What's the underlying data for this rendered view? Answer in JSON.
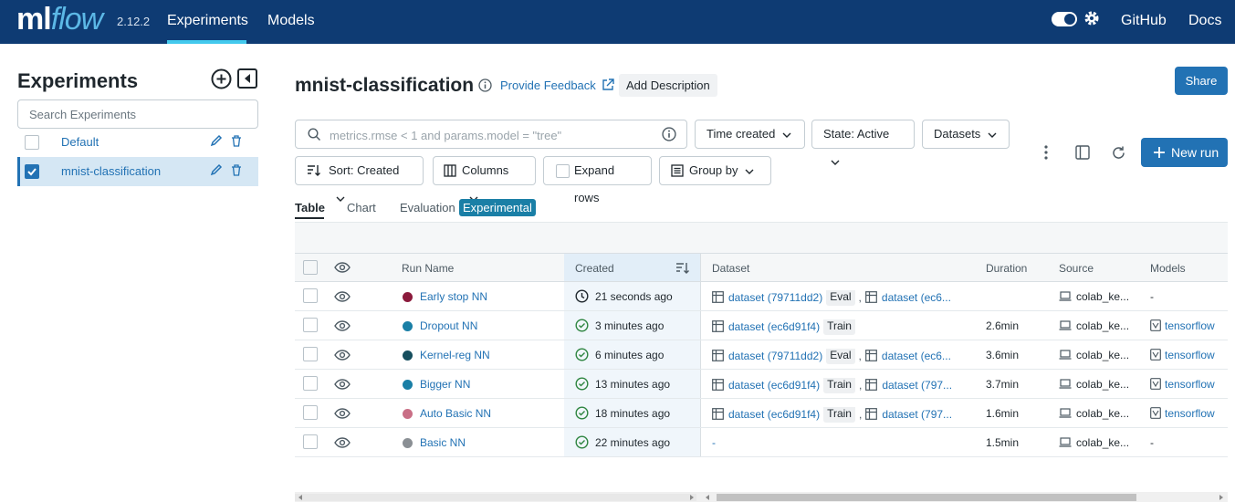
{
  "topbar": {
    "logo_ml": "ml",
    "logo_flow": "flow",
    "version": "2.12.2",
    "nav": [
      {
        "label": "Experiments",
        "active": true
      },
      {
        "label": "Models",
        "active": false
      }
    ],
    "right_links": [
      "GitHub",
      "Docs"
    ],
    "bg_color": "#0e3b73"
  },
  "sidebar": {
    "title": "Experiments",
    "search_placeholder": "Search Experiments",
    "experiments": [
      {
        "name": "Default",
        "checked": false
      },
      {
        "name": "mnist-classification",
        "checked": true
      }
    ]
  },
  "header": {
    "title": "mnist-classification",
    "feedback_label": "Provide Feedback",
    "add_description_label": "Add Description",
    "share_label": "Share"
  },
  "filters": {
    "search_placeholder": "metrics.rmse < 1 and params.model = \"tree\"",
    "time_created": "Time created",
    "state": "State: Active",
    "datasets": "Datasets",
    "sort": "Sort: Created",
    "columns": "Columns",
    "expand_rows": "Expand rows",
    "group_by": "Group by",
    "new_run": "New run"
  },
  "tabs": [
    {
      "label": "Table",
      "active": true
    },
    {
      "label": "Chart",
      "active": false
    },
    {
      "label": "Evaluation",
      "active": false
    }
  ],
  "experimental_badge": "Experimental",
  "table": {
    "headers": {
      "run_name": "Run Name",
      "created": "Created",
      "dataset": "Dataset",
      "duration": "Duration",
      "source": "Source",
      "models": "Models"
    },
    "rows": [
      {
        "name": "Early stop NN",
        "color": "#8b1a3c",
        "created": "21 seconds ago",
        "status": "running",
        "ds1": "dataset (79711dd2)",
        "tag1": "Eval",
        "ds2": "dataset (ec6...",
        "duration": "",
        "source": "colab_ke...",
        "model": "-"
      },
      {
        "name": "Dropout NN",
        "color": "#1a7fa6",
        "created": "3 minutes ago",
        "status": "finished",
        "ds1": "dataset (ec6d91f4)",
        "tag1": "Train",
        "ds2": "",
        "duration": "2.6min",
        "source": "colab_ke...",
        "model": "tensorflow"
      },
      {
        "name": "Kernel-reg NN",
        "color": "#164e5e",
        "created": "6 minutes ago",
        "status": "finished",
        "ds1": "dataset (79711dd2)",
        "tag1": "Eval",
        "ds2": "dataset (ec6...",
        "duration": "3.6min",
        "source": "colab_ke...",
        "model": "tensorflow"
      },
      {
        "name": "Bigger NN",
        "color": "#1a7fa6",
        "created": "13 minutes ago",
        "status": "finished",
        "ds1": "dataset (ec6d91f4)",
        "tag1": "Train",
        "ds2": "dataset (797...",
        "duration": "3.7min",
        "source": "colab_ke...",
        "model": "tensorflow"
      },
      {
        "name": "Auto Basic NN",
        "color": "#c96f86",
        "created": "18 minutes ago",
        "status": "finished",
        "ds1": "dataset (ec6d91f4)",
        "tag1": "Train",
        "ds2": "dataset (797...",
        "duration": "1.6min",
        "source": "colab_ke...",
        "model": "tensorflow"
      },
      {
        "name": "Basic NN",
        "color": "#8a8f94",
        "created": "22 minutes ago",
        "status": "finished",
        "ds1": "-",
        "tag1": "",
        "ds2": "",
        "duration": "1.5min",
        "source": "colab_ke...",
        "model": "-"
      }
    ]
  }
}
